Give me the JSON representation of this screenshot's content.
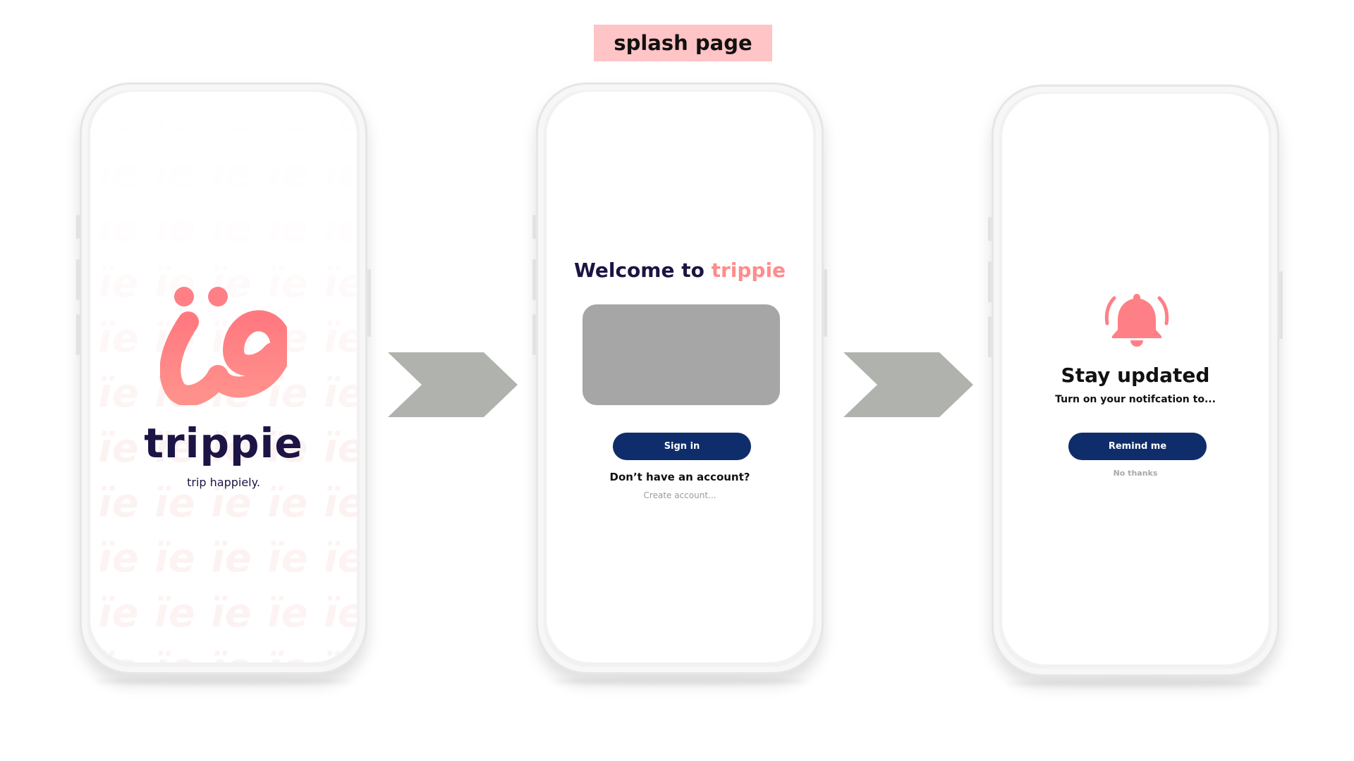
{
  "header": {
    "label": "splash page"
  },
  "colors": {
    "brand_pink": "#ff8c8c",
    "brand_navy": "#1b1444",
    "button_navy": "#0f2d6b",
    "label_bg": "#ffc4c5",
    "arrow_gray": "#b0b2ad",
    "placeholder_gray": "#a6a6a6"
  },
  "splash": {
    "logo_icon": "ie-logo-mark",
    "wordmark": "trippie",
    "tagline": "trip happiely."
  },
  "welcome": {
    "title_prefix": "Welcome to ",
    "title_brand": "trippie",
    "sign_in_label": "Sign in",
    "question": "Don’t have an account?",
    "create_account": "Create account..."
  },
  "notification": {
    "icon": "bell-ringing-icon",
    "title": "Stay updated",
    "subtitle": "Turn on your notifcation to...",
    "remind_label": "Remind me",
    "decline_label": "No thanks"
  },
  "flow": {
    "arrow_icon": "chevron-right-arrow"
  }
}
